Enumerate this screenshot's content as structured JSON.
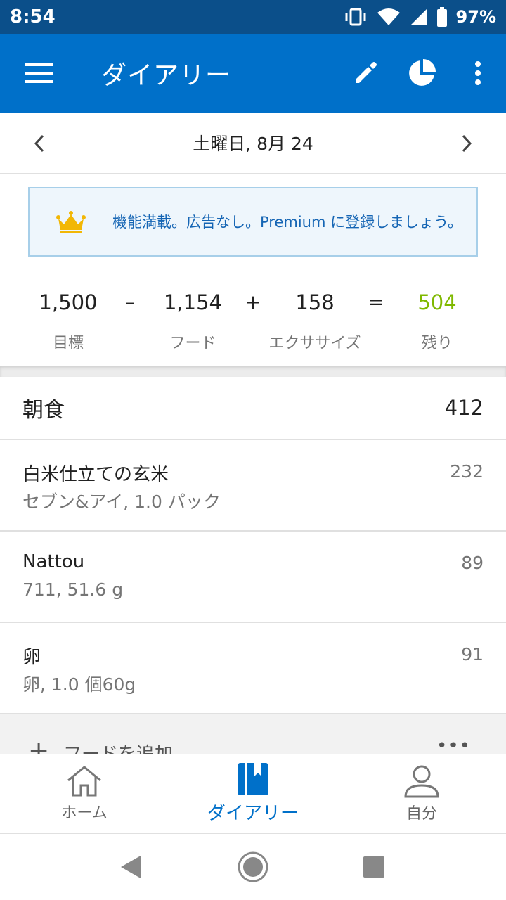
{
  "status": {
    "time": "8:54",
    "battery": "97%"
  },
  "app_bar": {
    "title": "ダイアリー"
  },
  "date_bar": {
    "date": "土曜日, 8月 24"
  },
  "premium": {
    "text": "機能満載。広告なし。Premium に登録しましょう。"
  },
  "summary": {
    "goal": {
      "value": "1,500",
      "label": "目標"
    },
    "minus": "–",
    "food": {
      "value": "1,154",
      "label": "フード"
    },
    "plus": "+",
    "exercise": {
      "value": "158",
      "label": "エクササイズ"
    },
    "equals": "=",
    "remaining": {
      "value": "504",
      "label": "残り"
    }
  },
  "meal": {
    "name": "朝食",
    "calories": "412",
    "items": [
      {
        "name": "白米仕立ての玄米",
        "desc": "セブン&アイ, 1.0 パック",
        "calories": "232"
      },
      {
        "name": "Nattou",
        "desc": "711, 51.6 g",
        "calories": "89"
      },
      {
        "name": "卵",
        "desc": "卵, 1.0 個60g",
        "calories": "91"
      }
    ],
    "add_label": "フードを追加",
    "more": "•••"
  },
  "bottom_nav": {
    "home": "ホーム",
    "diary": "ダイアリー",
    "me": "自分"
  },
  "colors": {
    "primary": "#0070c9",
    "status_bar": "#0b4f8a",
    "remaining": "#7fb800",
    "premium_text": "#1565b4"
  }
}
